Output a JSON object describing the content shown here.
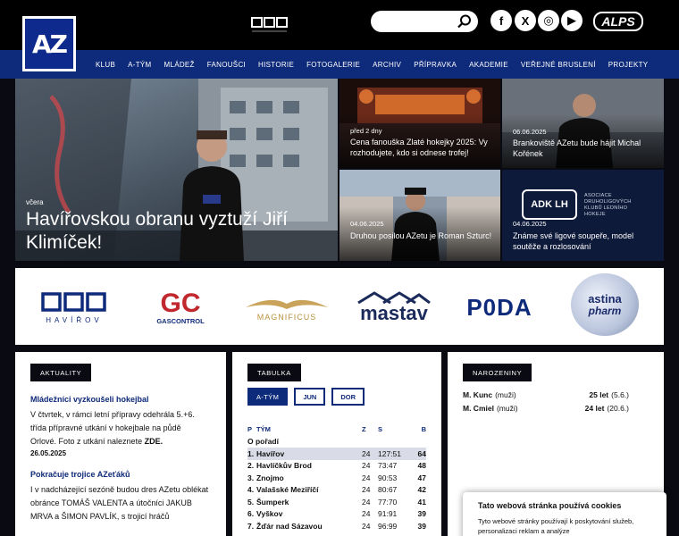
{
  "brand": {
    "logo_text": "AZ"
  },
  "search": {
    "placeholder": ""
  },
  "social": [
    {
      "name": "facebook",
      "glyph": "f"
    },
    {
      "name": "x",
      "glyph": "X"
    },
    {
      "name": "instagram",
      "glyph": "◎"
    },
    {
      "name": "youtube",
      "glyph": "▶"
    }
  ],
  "top_sponsor": "ALPS",
  "nav": [
    "KLUB",
    "A-TÝM",
    "MLÁDEŽ",
    "FANOUŠCI",
    "HISTORIE",
    "FOTOGALERIE",
    "ARCHIV",
    "PŘÍPRAVKA",
    "AKADEMIE",
    "VEŘEJNÉ BRUSLENÍ",
    "PROJEKTY"
  ],
  "hero": {
    "date": "včera",
    "title": "Havířovskou obranu vyztuží Jiří Klimíček!"
  },
  "tiles": [
    {
      "date": "před 2 dny",
      "title": "Cena fanouška Zlaté hokejky 2025: Vy rozhodujete, kdo si odnese trofej!"
    },
    {
      "date": "06.06.2025",
      "title": "Brankoviště AZetu bude hájit Michal Kořének"
    },
    {
      "date": "04.06.2025",
      "title": "Druhou posilou AZetu je Roman Szturc!"
    },
    {
      "date": "04.06.2025",
      "title": "Známe své ligové soupeře, model soutěže a rozlosování"
    }
  ],
  "adk": {
    "short": "ADK LH",
    "long": "ASOCIACE DRUHOLIGOVÝCH KLUBŮ LEDNÍHO HOKEJE"
  },
  "sponsors": {
    "havirov": "HAVÍŘOV",
    "gc_big": "GC",
    "gc_small": "GASCONTROL",
    "magnificus": "MAGNIFICUS",
    "mastav": "mastav",
    "poda": "P0DA",
    "astina_1": "astina",
    "astina_2": "pharm"
  },
  "news": {
    "tag": "AKTUALITY",
    "items": [
      {
        "title": "Mládežníci vyzkoušeli hokejbal",
        "text": "V čtvrtek, v rámci letní přípravy odehrála 5.+6. třída přípravné utkání v hokejbale na půdě Orlové. Foto z utkání naleznete",
        "link": "ZDE.",
        "date": "26.05.2025"
      },
      {
        "title": "Pokračuje trojice AZeťáků",
        "text": "I v nadcházející sezóně budou dres AZetu oblékat obránce TOMÁŠ VALENTA a útočníci JAKUB MRVA a ŠIMON PAVLÍK, s trojicí hráčů",
        "link": "",
        "date": ""
      }
    ]
  },
  "table": {
    "tag": "TABULKA",
    "tabs": [
      "A-TÝM",
      "JUN",
      "DOR"
    ],
    "headers": {
      "p": "P",
      "team": "TÝM",
      "z": "Z",
      "s": "S",
      "b": "B"
    },
    "subhead": "O pořadí",
    "rows": [
      {
        "p": "1.",
        "team": "Havířov",
        "z": "24",
        "s": "127:51",
        "b": "64",
        "highlight": true
      },
      {
        "p": "2.",
        "team": "Havlíčkův Brod",
        "z": "24",
        "s": "73:47",
        "b": "48"
      },
      {
        "p": "3.",
        "team": "Znojmo",
        "z": "24",
        "s": "90:53",
        "b": "47"
      },
      {
        "p": "4.",
        "team": "Valašské Meziříčí",
        "z": "24",
        "s": "80:67",
        "b": "42"
      },
      {
        "p": "5.",
        "team": "Šumperk",
        "z": "24",
        "s": "77:70",
        "b": "41"
      },
      {
        "p": "6.",
        "team": "Vyškov",
        "z": "24",
        "s": "91:91",
        "b": "39"
      },
      {
        "p": "7.",
        "team": "Žďár nad Sázavou",
        "z": "24",
        "s": "96:99",
        "b": "39"
      }
    ]
  },
  "birthdays": {
    "tag": "NAROZENINY",
    "items": [
      {
        "name": "M. Kunc",
        "group": "(muži)",
        "age": "25 let",
        "date": "(5.6.)"
      },
      {
        "name": "M. Cmiel",
        "group": "(muži)",
        "age": "24 let",
        "date": "(20.6.)"
      }
    ]
  },
  "cookie": {
    "title": "Tato webová stránka používá cookies",
    "text": "Tyto webové stránky používají k poskytování služeb, personalizaci reklam a analýze"
  },
  "colors": {
    "brand_blue": "#0e2a7a",
    "dark": "#0a0a12"
  }
}
